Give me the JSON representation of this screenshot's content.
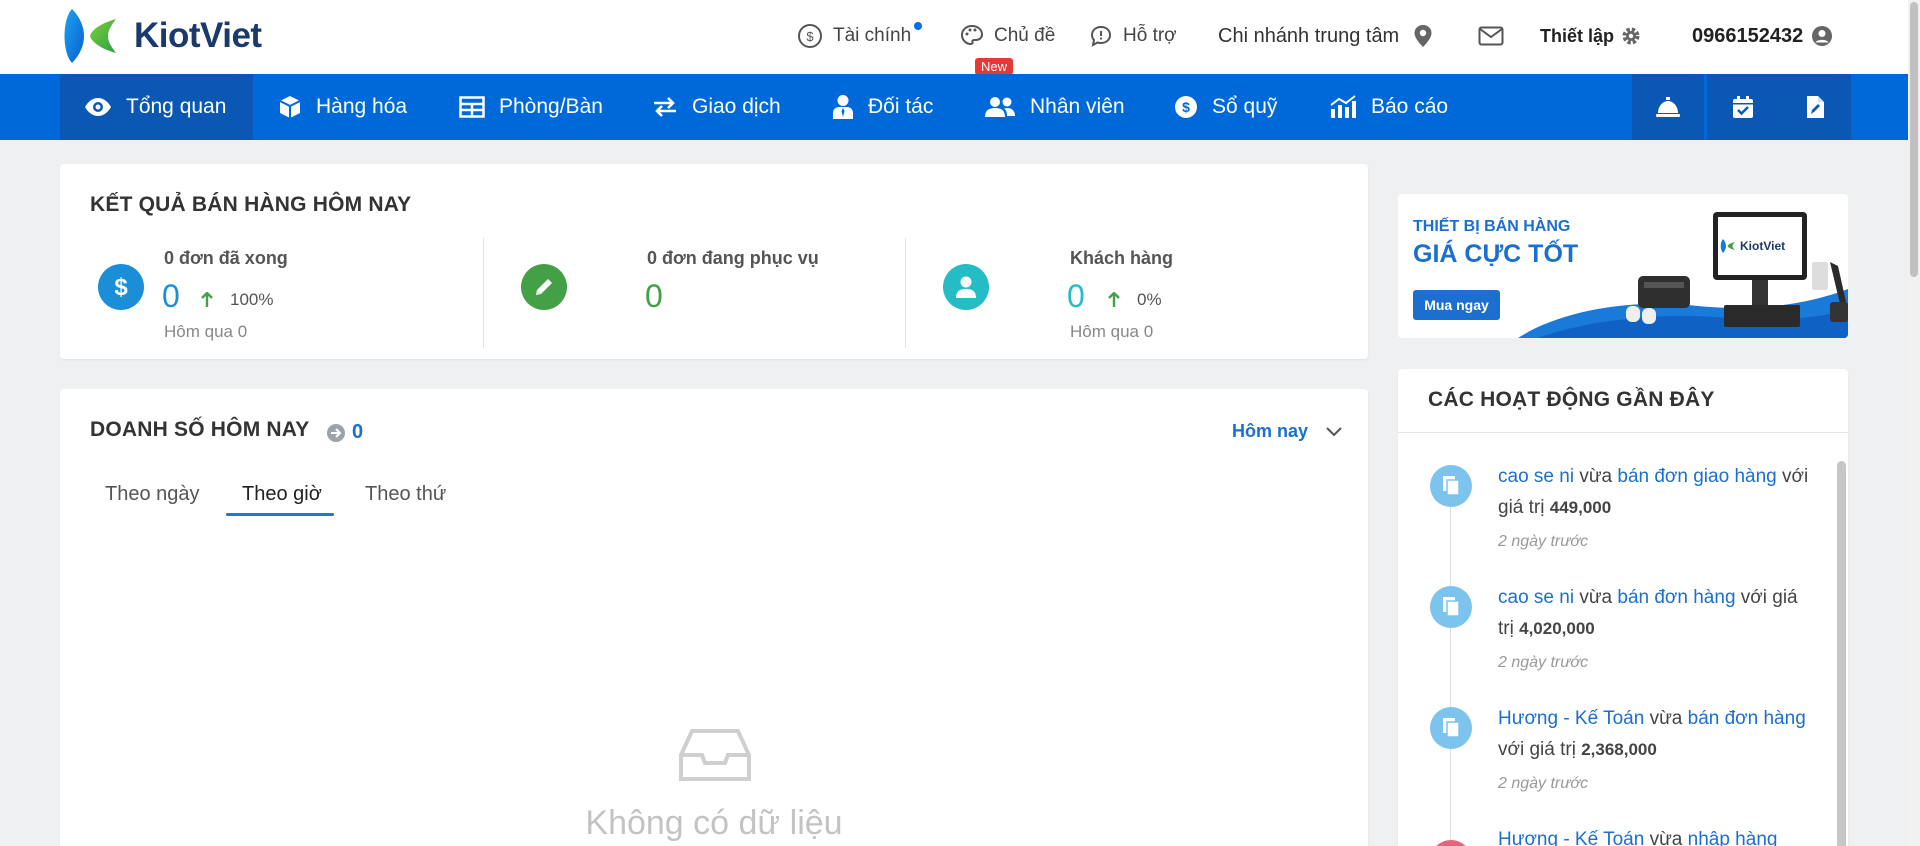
{
  "brand": {
    "name": "KiotViet"
  },
  "header": {
    "finance": "Tài chính",
    "theme": "Chủ đề",
    "new_badge": "New",
    "support": "Hỗ trợ",
    "branch": "Chi nhánh trung tâm",
    "settings": "Thiết lập",
    "phone": "0966152432"
  },
  "nav": {
    "items": [
      {
        "label": "Tổng quan",
        "icon": "eye-icon",
        "active": true
      },
      {
        "label": "Hàng hóa",
        "icon": "box-icon"
      },
      {
        "label": "Phòng/Bàn",
        "icon": "table-icon"
      },
      {
        "label": "Giao dịch",
        "icon": "exchange-icon"
      },
      {
        "label": "Đối tác",
        "icon": "partner-icon"
      },
      {
        "label": "Nhân viên",
        "icon": "users-icon"
      },
      {
        "label": "Sổ quỹ",
        "icon": "dollar-circle-icon"
      },
      {
        "label": "Báo cáo",
        "icon": "chart-icon"
      }
    ],
    "quick_icons": [
      "bell-service-icon",
      "calendar-check-icon",
      "file-edit-icon"
    ]
  },
  "sales_today": {
    "title": "KẾT QUẢ BÁN HÀNG HÔM NAY",
    "stats": [
      {
        "label": "0 đơn đã xong",
        "value": "0",
        "change": "100%",
        "previous": "Hôm qua 0",
        "color": "#1a8fd8"
      },
      {
        "label": "0 đơn đang phục vụ",
        "value": "0",
        "color": "#43a047"
      },
      {
        "label": "Khách hàng",
        "value": "0",
        "change": "0%",
        "previous": "Hôm qua 0",
        "color": "#26bcc6"
      }
    ]
  },
  "revenue": {
    "title": "DOANH SỐ HÔM NAY",
    "total": "0",
    "period": "Hôm nay",
    "tabs": [
      "Theo ngày",
      "Theo giờ",
      "Theo thứ"
    ],
    "active_tab": "Theo giờ",
    "empty": "Không có dữ liệu"
  },
  "banner": {
    "line1": "THIẾT BỊ BÁN HÀNG",
    "line2": "GIÁ CỰC TỐT",
    "button": "Mua ngay",
    "device_brand": "KiotViet"
  },
  "activity": {
    "title": "CÁC HOẠT ĐỘNG GẦN ĐÂY",
    "items": [
      {
        "user": "cao se ni",
        "verb": " vừa ",
        "action": "bán đơn giao hàng",
        "value_prefix": " với giá trị ",
        "value": "449,000",
        "time": "2 ngày trước"
      },
      {
        "user": "cao se ni",
        "verb": " vừa ",
        "action": "bán đơn hàng",
        "value_prefix": " với giá trị ",
        "value": "4,020,000",
        "time": "2 ngày trước"
      },
      {
        "user": "Hương - Kế Toán",
        "verb": " vừa ",
        "action": "bán đơn hàng",
        "value_prefix": " với giá trị ",
        "value": "2,368,000",
        "time": "2 ngày trước"
      },
      {
        "user": "Hương - Kế Toán",
        "verb": " vừa ",
        "action": "nhập hàng"
      }
    ]
  }
}
